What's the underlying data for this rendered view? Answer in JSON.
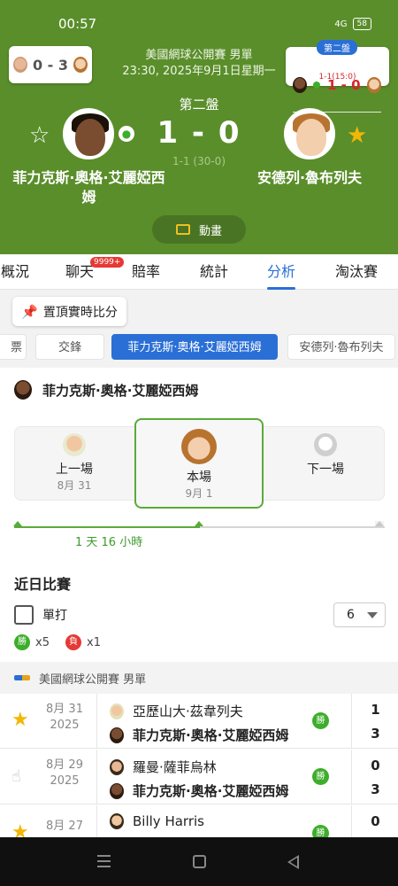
{
  "status_bar": {
    "time": "00:57",
    "signal": "4G",
    "battery": "58"
  },
  "mini_left": {
    "score": "0 - 3"
  },
  "mini_right": {
    "badge": "第二盤",
    "score": "1 - 0",
    "sub": "1-1(15:0)"
  },
  "match": {
    "tournament": "美國網球公開賽 男單",
    "datetime": "23:30, 2025年9月1日星期一",
    "set_label": "第二盤",
    "score": "1 - 0",
    "sub_score": "1-1 (30-0)",
    "player_left": "菲力克斯·奧格·艾麗婭西姆",
    "player_right": "安德列·魯布列夫",
    "animation_label": "動畫"
  },
  "tabs": [
    {
      "label": "概況"
    },
    {
      "label": "聊天",
      "badge": "9999+"
    },
    {
      "label": "賠率"
    },
    {
      "label": "統計"
    },
    {
      "label": "分析",
      "active": true
    },
    {
      "label": "淘汰賽"
    }
  ],
  "pin_button": "置頂實時比分",
  "chips": [
    "票",
    "交鋒",
    "菲力克斯·奧格·艾麗婭西姆",
    "安德列·魯布列夫"
  ],
  "player_header": "菲力克斯·奧格·艾麗婭西姆",
  "timeline": {
    "prev": {
      "label": "上一場",
      "date": "8月 31"
    },
    "current": {
      "label": "本場",
      "date": "9月 1"
    },
    "next": {
      "label": "下一場"
    },
    "gap": "1 天 16 小時"
  },
  "recent": {
    "title": "近日比賽",
    "single_label": "單打",
    "count": "6",
    "win_label": "勝",
    "win_count": "x5",
    "loss_label": "負",
    "loss_count": "x1",
    "section": "美國網球公開賽 男單"
  },
  "matches": [
    {
      "date": "8月 31",
      "year": "2025",
      "p1": "亞歷山大·茲韋列夫",
      "p2": "菲力克斯·奧格·艾麗婭西姆",
      "s1": "1",
      "s2": "3",
      "result": "勝"
    },
    {
      "date": "8月 29",
      "year": "2025",
      "p1": "羅曼·薩菲烏林",
      "p2": "菲力克斯·奧格·艾麗婭西姆",
      "s1": "0",
      "s2": "3",
      "result": "勝"
    },
    {
      "date": "8月 27",
      "year": "",
      "p1": "Billy Harris",
      "p2": "",
      "s1": "0",
      "s2": "",
      "result": "勝"
    }
  ],
  "colors": {
    "header_green": "#5a8e2b",
    "accent_blue": "#2a6fd6",
    "win_green": "#3dae2b",
    "loss_red": "#e53935",
    "star_gold": "#f2b705"
  }
}
